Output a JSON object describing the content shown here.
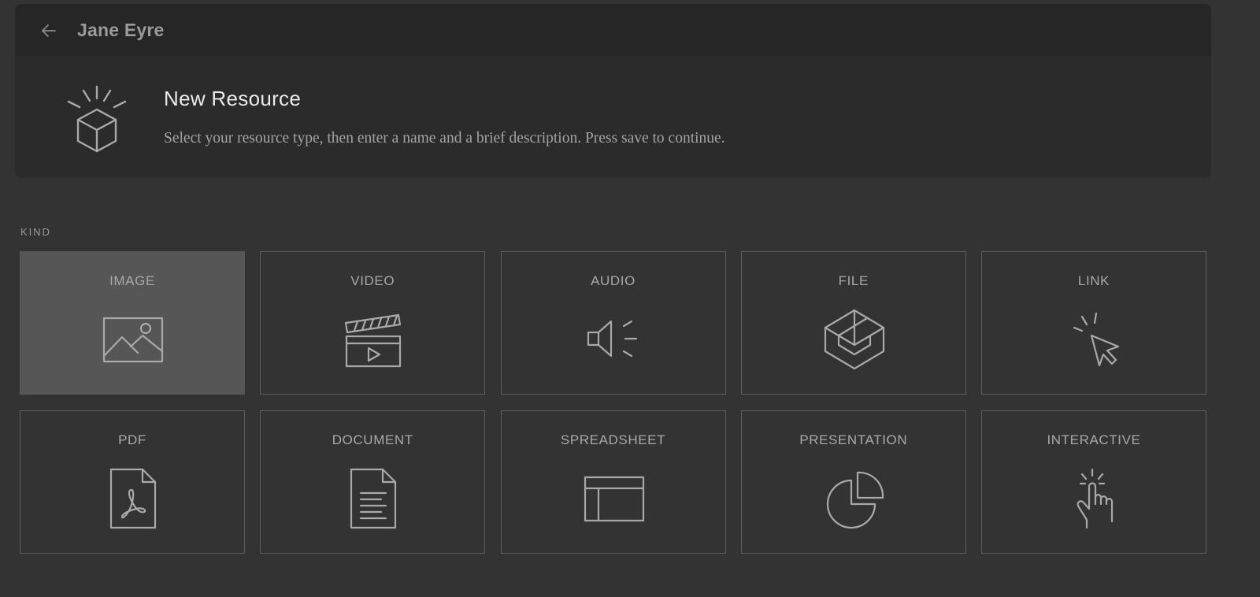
{
  "header": {
    "back_icon": "arrow-left-icon",
    "title": "Jane Eyre"
  },
  "intro": {
    "icon": "box-burst-icon",
    "title": "New Resource",
    "description": "Select your resource type, then enter a name and a brief description. Press save to continue."
  },
  "kind": {
    "label": "KIND",
    "selected": "IMAGE",
    "tiles": [
      {
        "label": "IMAGE",
        "icon": "image-icon"
      },
      {
        "label": "VIDEO",
        "icon": "clapperboard-icon"
      },
      {
        "label": "AUDIO",
        "icon": "speaker-icon"
      },
      {
        "label": "FILE",
        "icon": "cube-icon"
      },
      {
        "label": "LINK",
        "icon": "cursor-click-icon"
      },
      {
        "label": "PDF",
        "icon": "pdf-file-icon"
      },
      {
        "label": "DOCUMENT",
        "icon": "document-icon"
      },
      {
        "label": "SPREADSHEET",
        "icon": "spreadsheet-icon"
      },
      {
        "label": "PRESENTATION",
        "icon": "pie-chart-icon"
      },
      {
        "label": "INTERACTIVE",
        "icon": "hand-tap-icon"
      }
    ]
  },
  "colors": {
    "background": "#333333",
    "header_bg": "#262626",
    "intro_bg": "#2b2b2b",
    "tile_border": "#5e5e5e",
    "tile_selected_bg": "#565656",
    "icon_stroke": "#a9a9a9"
  }
}
